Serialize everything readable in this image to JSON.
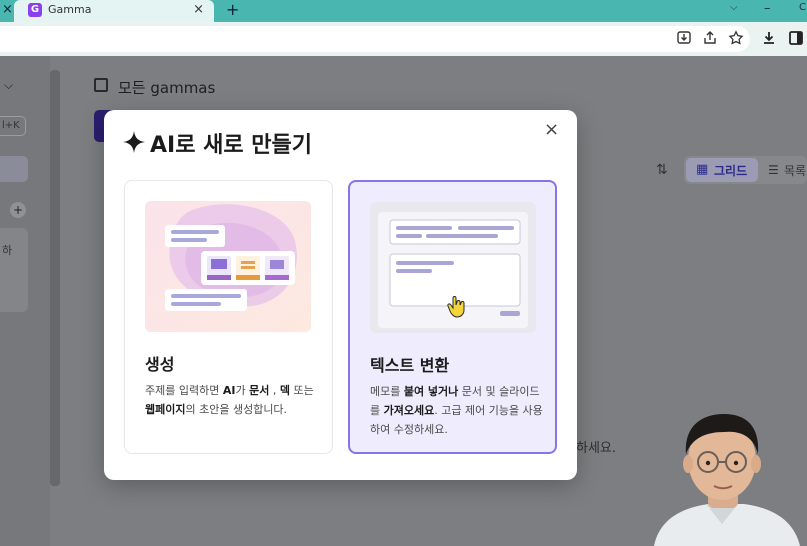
{
  "browser": {
    "tab_title": "Gamma",
    "tab_close_glyph": "×",
    "prev_tab_close_glyph": "×",
    "new_tab_glyph": "+",
    "tab_dropdown_glyph": "⌵",
    "minimize_glyph": "–",
    "edge_glyph": "C"
  },
  "toolbar_icons": [
    "install-icon",
    "share-icon",
    "star-icon",
    "download-icon",
    "sidepanel-icon"
  ],
  "sidebar": {
    "chevron": "⌵",
    "shortcut_fragment": "l+K",
    "add_glyph": "+",
    "card_fragment": "하"
  },
  "main": {
    "section_title": "모든 gammas",
    "sort_glyph": "⇅",
    "view_grid_label": "그리드",
    "view_list_label": "목록",
    "empty_hint_fragment": "하세요."
  },
  "modal": {
    "title": "AI로 새로 만들기",
    "close_glyph": "×",
    "cards": [
      {
        "title": "생성",
        "desc_parts": [
          "주제를 입력하면 ",
          "AI",
          "가 ",
          "문서",
          " , ",
          "덱",
          " 또는 ",
          "웹페이지",
          "의 초안을 생성합니다."
        ]
      },
      {
        "title": "텍스트 변환",
        "desc_parts": [
          "메모를 ",
          "붙여 넣거나",
          " 문서 및 슬라이드를 ",
          "가져오세요",
          ". 고급 제어 기능을 사용하여 수정하세요."
        ]
      }
    ]
  },
  "colors": {
    "accent": "#8a72e8",
    "selected_card_bg": "#efecfe",
    "tabbar": "#49b6b0"
  }
}
